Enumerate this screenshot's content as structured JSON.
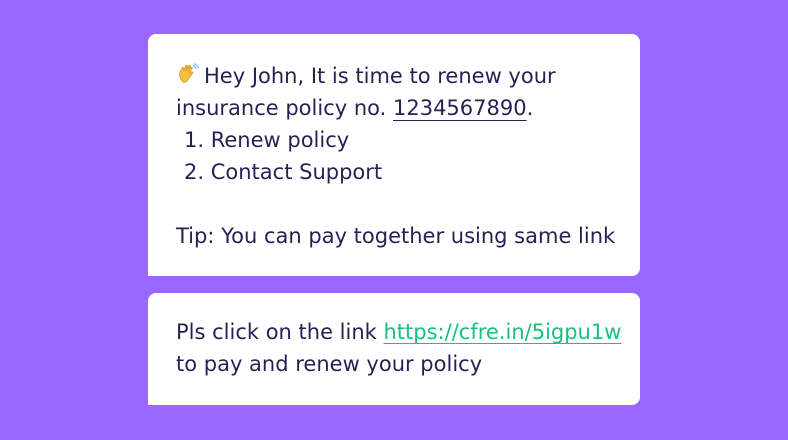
{
  "messages": [
    {
      "emoji": "wave-emoji",
      "greeting_line": "Hey John, It is time to renew your",
      "policy_prefix": "insurance policy no. ",
      "policy_number": "1234567890",
      "policy_suffix": ".",
      "options": [
        {
          "number": "1.",
          "label": "Renew policy"
        },
        {
          "number": "2.",
          "label": "Contact Support"
        }
      ],
      "tip": "Tip: You can pay together using same link"
    },
    {
      "prefix": "Pls click on the link ",
      "link_text": "https://cfre.in/5igpu1w",
      "suffix": "to pay and renew your policy"
    }
  ],
  "colors": {
    "background": "#9966ff",
    "bubble": "#ffffff",
    "text": "#2a1f55",
    "link": "#17c27a"
  }
}
